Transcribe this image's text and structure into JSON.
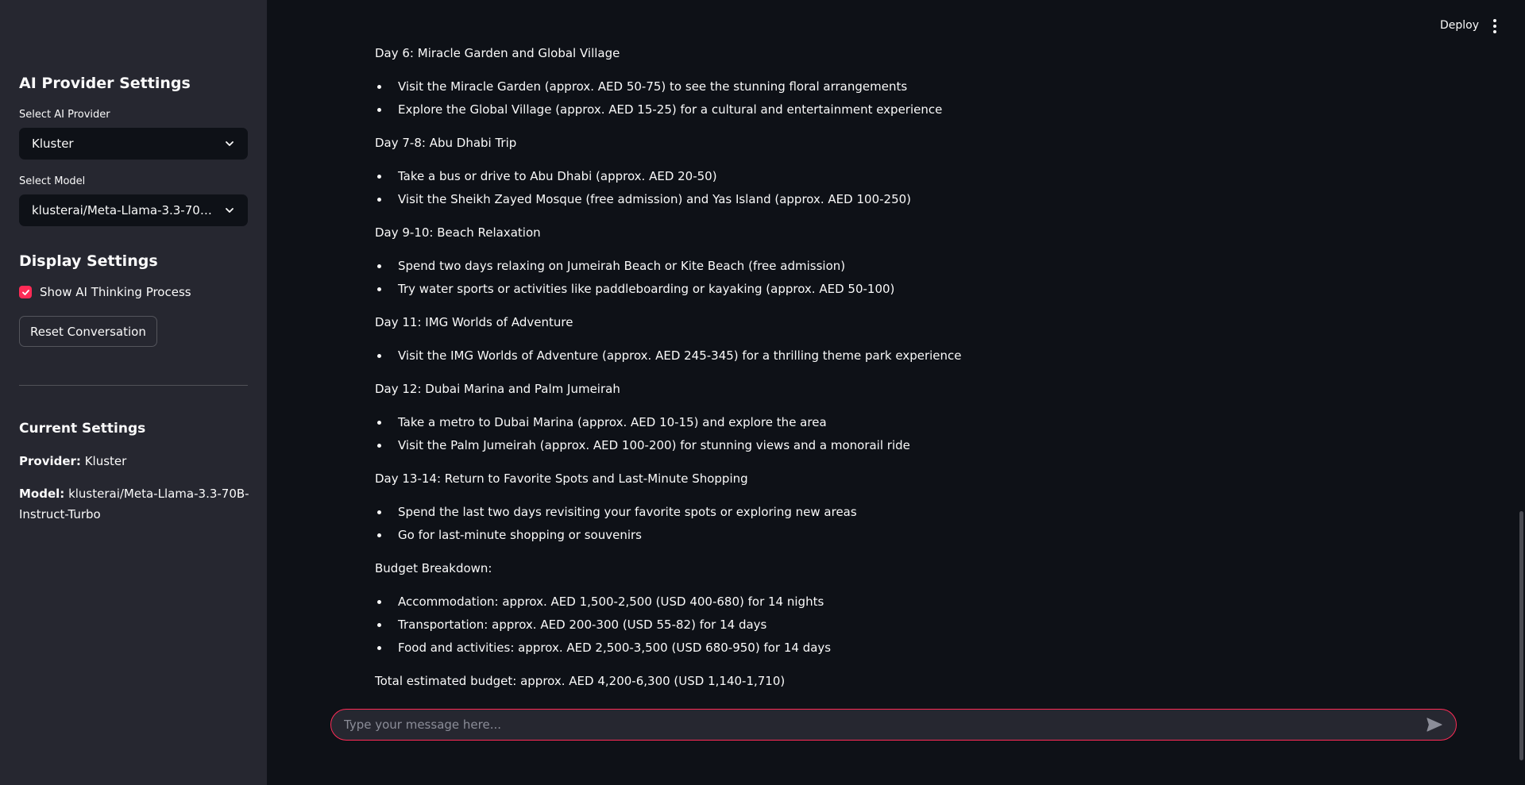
{
  "header": {
    "deploy_label": "Deploy"
  },
  "sidebar": {
    "title": "AI Provider Settings",
    "provider_label": "Select AI Provider",
    "provider_value": "Kluster",
    "model_label": "Select Model",
    "model_value": "klusterai/Meta-Llama-3.3-70B-Instruct-Turbo",
    "display_title": "Display Settings",
    "show_thinking_label": "Show AI Thinking Process",
    "show_thinking_checked": true,
    "reset_label": "Reset Conversation",
    "current_title": "Current Settings",
    "provider_key": "Provider:",
    "provider_current": " Kluster",
    "model_key": "Model:",
    "model_current": " klusterai/Meta-Llama-3.3-70B-Instruct-Turbo"
  },
  "message": {
    "sections": [
      {
        "heading": "Day 6: Miracle Garden and Global Village",
        "items": [
          "Visit the Miracle Garden (approx. AED 50-75) to see the stunning floral arrangements",
          "Explore the Global Village (approx. AED 15-25) for a cultural and entertainment experience"
        ]
      },
      {
        "heading": "Day 7-8: Abu Dhabi Trip",
        "items": [
          "Take a bus or drive to Abu Dhabi (approx. AED 20-50)",
          "Visit the Sheikh Zayed Mosque (free admission) and Yas Island (approx. AED 100-250)"
        ]
      },
      {
        "heading": "Day 9-10: Beach Relaxation",
        "items": [
          "Spend two days relaxing on Jumeirah Beach or Kite Beach (free admission)",
          "Try water sports or activities like paddleboarding or kayaking (approx. AED 50-100)"
        ]
      },
      {
        "heading": "Day 11: IMG Worlds of Adventure",
        "items": [
          "Visit the IMG Worlds of Adventure (approx. AED 245-345) for a thrilling theme park experience"
        ]
      },
      {
        "heading": "Day 12: Dubai Marina and Palm Jumeirah",
        "items": [
          "Take a metro to Dubai Marina (approx. AED 10-15) and explore the area",
          "Visit the Palm Jumeirah (approx. AED 100-200) for stunning views and a monorail ride"
        ]
      },
      {
        "heading": "Day 13-14: Return to Favorite Spots and Last-Minute Shopping",
        "items": [
          "Spend the last two days revisiting your favorite spots or exploring new areas",
          "Go for last-minute shopping or souvenirs"
        ]
      },
      {
        "heading": "Budget Breakdown:",
        "items": [
          "Accommodation: approx. AED 1,500-2,500 (USD 400-680) for 14 nights",
          "Transportation: approx. AED 200-300 (USD 55-82) for 14 days",
          "Food and activities: approx. AED 2,500-3,500 (USD 680-950) for 14 days"
        ]
      }
    ],
    "total": "Total estimated budget: approx. AED 4,200-6,300 (USD 1,140-1,710)"
  },
  "chat": {
    "placeholder": "Type your message here..."
  },
  "colors": {
    "accent": "#ff2b56",
    "sidebar_bg": "#262730",
    "main_bg": "#0e1117"
  }
}
